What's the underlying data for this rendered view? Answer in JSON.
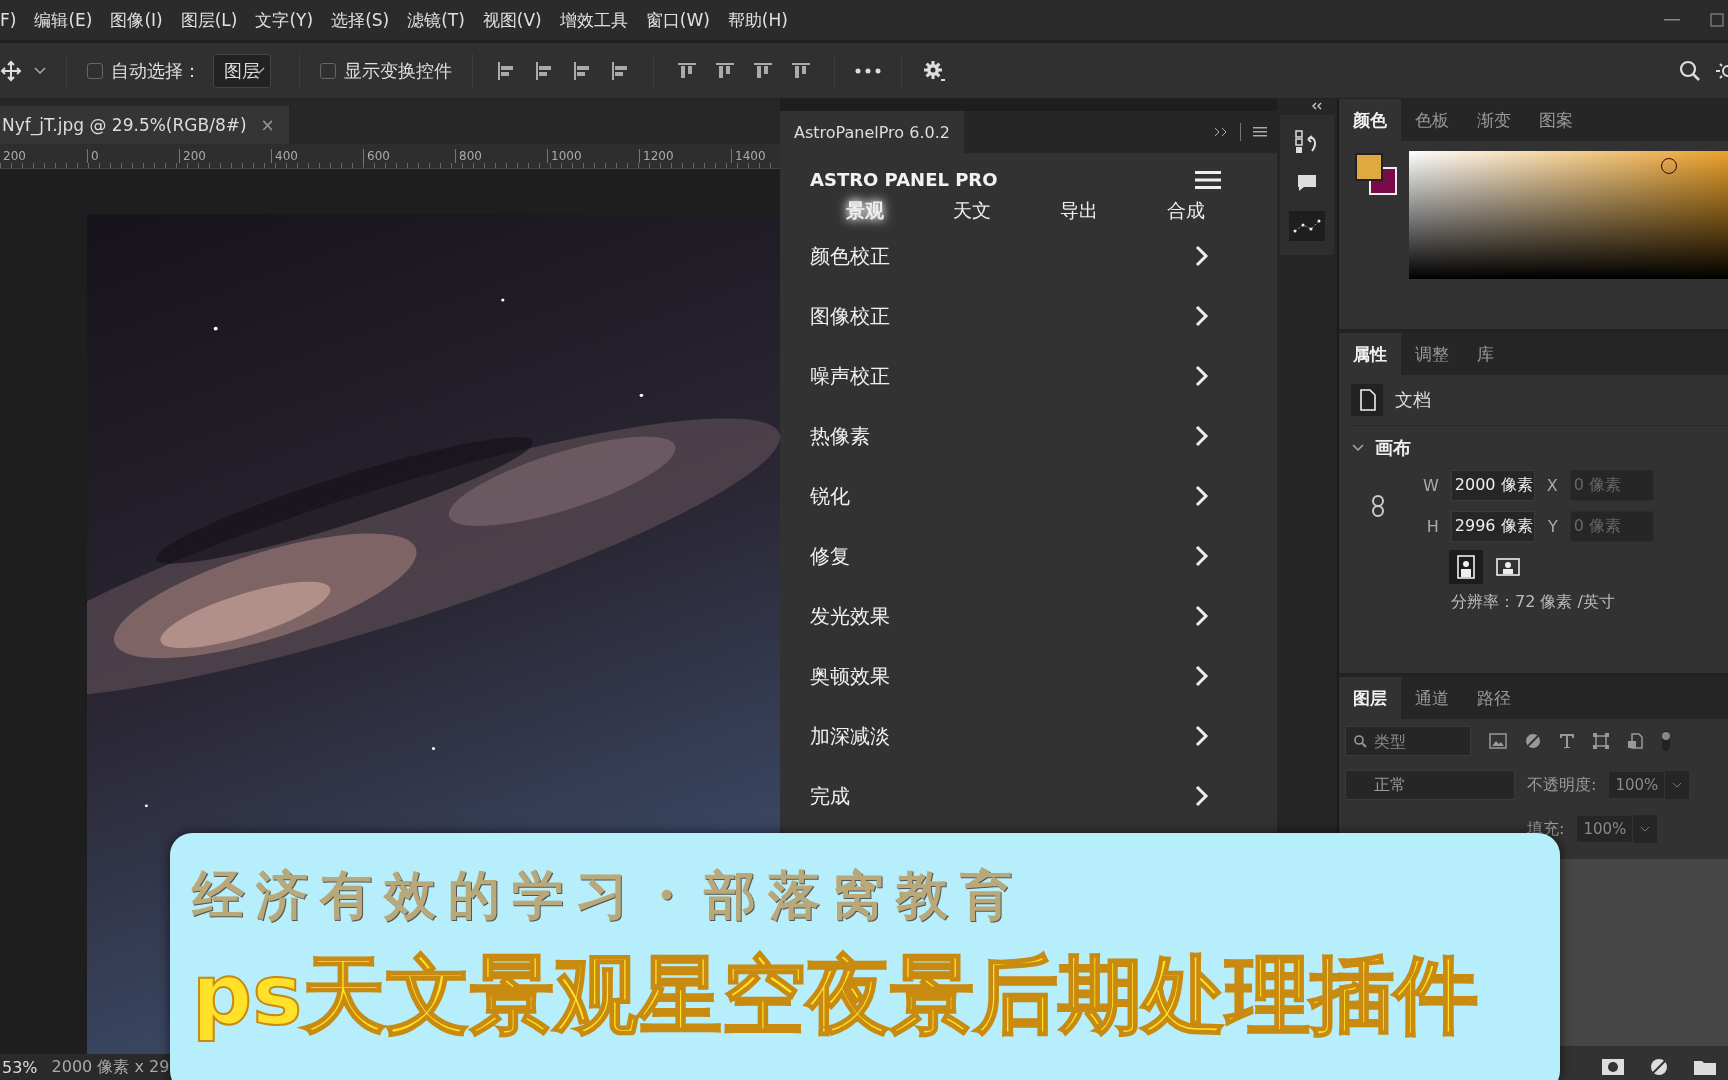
{
  "menu": [
    "F)",
    "编辑(E)",
    "图像(I)",
    "图层(L)",
    "文字(Y)",
    "选择(S)",
    "滤镜(T)",
    "视图(V)",
    "增效工具",
    "窗口(W)",
    "帮助(H)"
  ],
  "options_bar": {
    "auto_select": {
      "label": "自动选择：",
      "checked": false
    },
    "target": "图层",
    "show_transform": {
      "label": "显示变换控件",
      "checked": false
    }
  },
  "document": {
    "tab_title": "Nyf_jT.jpg @ 29.5%(RGB/8#)",
    "close": "×",
    "ruler": [
      "200",
      "0",
      "200",
      "400",
      "600",
      "800",
      "1000",
      "1200",
      "1400"
    ],
    "kind": "picture"
  },
  "status_bar": {
    "zoom": "53%",
    "info": "2000 像素 x 29"
  },
  "astro_panel": {
    "tab_title": "AstroPanelPro 6.0.2",
    "heading": "ASTRO PANEL PRO",
    "tabs": [
      {
        "label": "景观",
        "selected": true
      },
      {
        "label": "天文",
        "selected": false
      },
      {
        "label": "导出",
        "selected": false
      },
      {
        "label": "合成",
        "selected": false
      }
    ],
    "items": [
      "颜色校正",
      "图像校正",
      "噪声校正",
      "热像素",
      "锐化",
      "修复",
      "发光效果",
      "奥顿效果",
      "加深减淡",
      "完成"
    ]
  },
  "color_panel": {
    "tabs": [
      {
        "label": "颜色",
        "selected": true
      },
      {
        "label": "色板",
        "selected": false
      },
      {
        "label": "渐变",
        "selected": false
      },
      {
        "label": "图案",
        "selected": false
      }
    ]
  },
  "properties_panel": {
    "tabs": [
      {
        "label": "属性",
        "selected": true
      },
      {
        "label": "调整",
        "selected": false
      },
      {
        "label": "库",
        "selected": false
      }
    ],
    "document_label": "文档",
    "section": {
      "title": "画布",
      "expanded": true
    },
    "fields": [
      {
        "label": "W",
        "value": "2000 像素",
        "disabled": false
      },
      {
        "label": "X",
        "value": "0 像素",
        "disabled": true
      },
      {
        "label": "H",
        "value": "2996 像素",
        "disabled": false
      },
      {
        "label": "Y",
        "value": "0 像素",
        "disabled": true
      }
    ],
    "resolution": "分辨率：72 像素 /英寸"
  },
  "layers_panel": {
    "tabs": [
      {
        "label": "图层",
        "selected": true
      },
      {
        "label": "通道",
        "selected": false
      },
      {
        "label": "路径",
        "selected": false
      }
    ],
    "filter_placeholder": "类型",
    "blend_mode": "正常",
    "opacity_label": "不透明度:",
    "opacity": "100%",
    "fill_label": "填充:",
    "fill": "100%"
  },
  "banner": {
    "subtitle": "经济有效的学习・部落窝教育",
    "title": "ps天文景观星空夜景后期处理插件"
  }
}
